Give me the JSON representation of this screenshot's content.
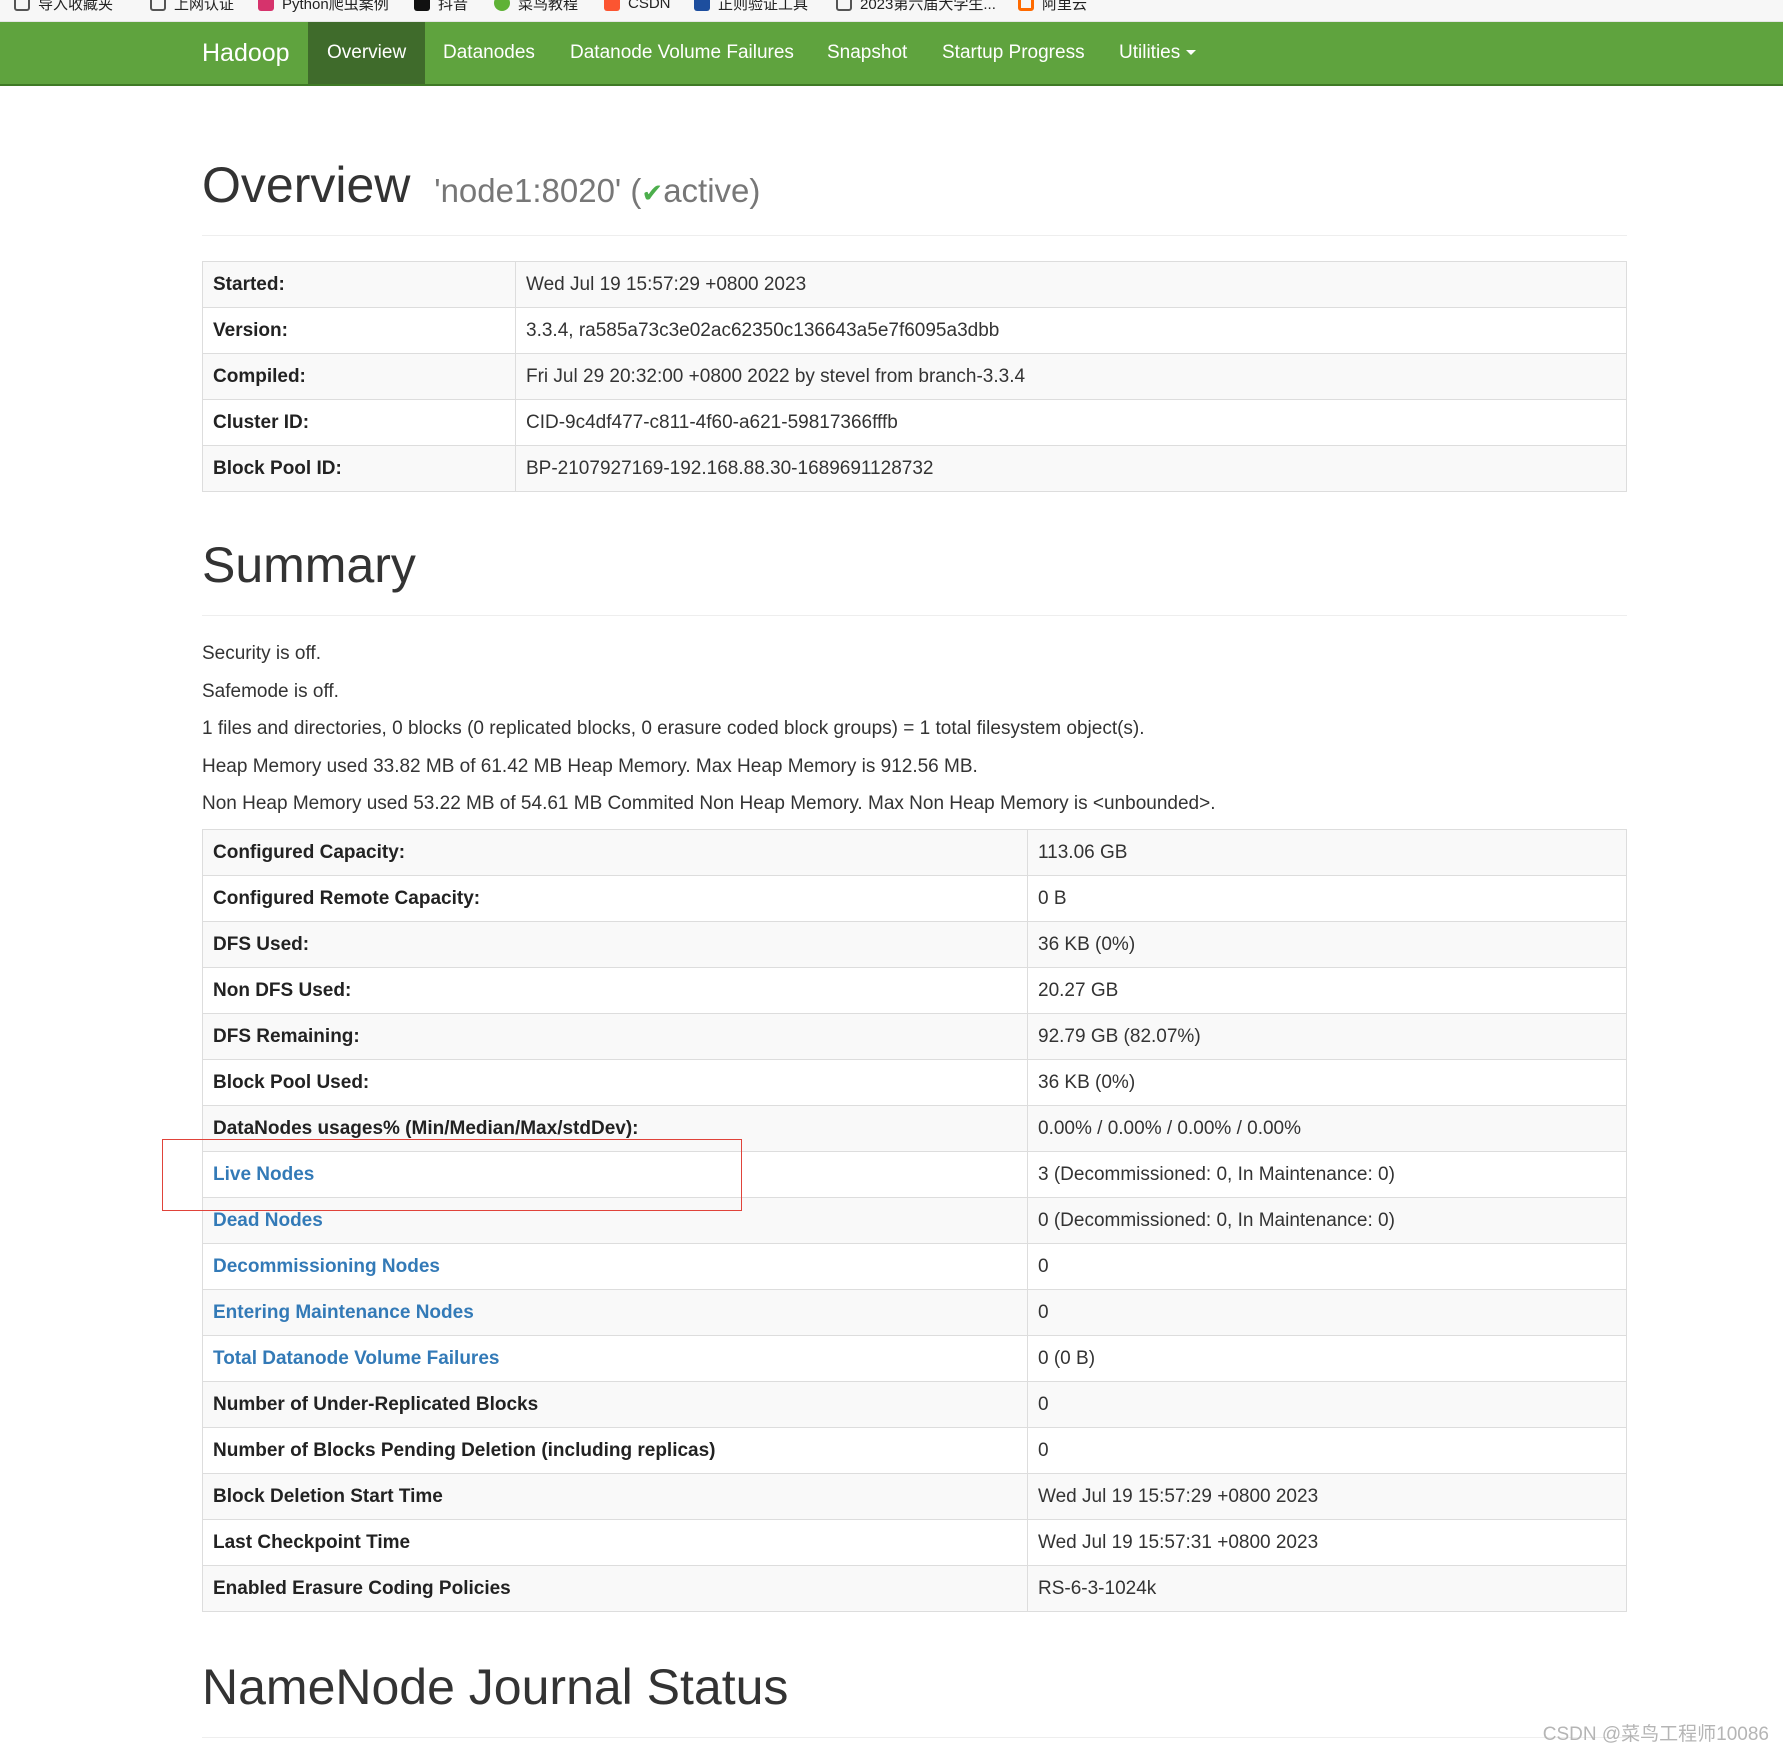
{
  "bookmarks": [
    {
      "label": "导入收藏夹",
      "color": "#555555"
    },
    {
      "label": "上网认证",
      "color": "#555555"
    },
    {
      "label": "Python爬虫案例",
      "color": "#d6336c"
    },
    {
      "label": "抖音",
      "color": "#111111"
    },
    {
      "label": "菜鸟教程",
      "color": "#5fb236"
    },
    {
      "label": "CSDN",
      "color": "#fc5531"
    },
    {
      "label": "正则验证工具",
      "color": "#1d4e9e"
    },
    {
      "label": "2023第六届大学生...",
      "color": "#555555"
    },
    {
      "label": "阿里云",
      "color": "#ff6a00"
    }
  ],
  "navbar": {
    "brand": "Hadoop",
    "items": [
      {
        "label": "Overview",
        "active": true
      },
      {
        "label": "Datanodes"
      },
      {
        "label": "Datanode Volume Failures"
      },
      {
        "label": "Snapshot"
      },
      {
        "label": "Startup Progress"
      },
      {
        "label": "Utilities",
        "dropdown": true
      }
    ],
    "colors": {
      "bar": "#5fa33e",
      "active": "#3f6b2b"
    }
  },
  "overview": {
    "title": "Overview",
    "host": "'node1:8020'",
    "state_open": "(",
    "state_icon": "✔",
    "state": "active)",
    "rows": [
      {
        "label": "Started:",
        "value": "Wed Jul 19 15:57:29 +0800 2023"
      },
      {
        "label": "Version:",
        "value": "3.3.4, ra585a73c3e02ac62350c136643a5e7f6095a3dbb"
      },
      {
        "label": "Compiled:",
        "value": "Fri Jul 29 20:32:00 +0800 2022 by stevel from branch-3.3.4"
      },
      {
        "label": "Cluster ID:",
        "value": "CID-9c4df477-c811-4f60-a621-59817366fffb"
      },
      {
        "label": "Block Pool ID:",
        "value": "BP-2107927169-192.168.88.30-1689691128732"
      }
    ]
  },
  "summary": {
    "title": "Summary",
    "lines": [
      "Security is off.",
      "Safemode is off.",
      "1 files and directories, 0 blocks (0 replicated blocks, 0 erasure coded block groups) = 1 total filesystem object(s).",
      "Heap Memory used 33.82 MB of 61.42 MB Heap Memory. Max Heap Memory is 912.56 MB.",
      "Non Heap Memory used 53.22 MB of 54.61 MB Commited Non Heap Memory. Max Non Heap Memory is <unbounded>."
    ],
    "rows": [
      {
        "label": "Configured Capacity:",
        "value": "113.06 GB"
      },
      {
        "label": "Configured Remote Capacity:",
        "value": "0 B"
      },
      {
        "label": "DFS Used:",
        "value": "36 KB (0%)"
      },
      {
        "label": "Non DFS Used:",
        "value": "20.27 GB"
      },
      {
        "label": "DFS Remaining:",
        "value": "92.79 GB (82.07%)"
      },
      {
        "label": "Block Pool Used:",
        "value": "36 KB (0%)"
      },
      {
        "label": "DataNodes usages% (Min/Median/Max/stdDev):",
        "value": "0.00% / 0.00% / 0.00% / 0.00%"
      },
      {
        "label": "Live Nodes",
        "value": "3 (Decommissioned: 0, In Maintenance: 0)",
        "link": true
      },
      {
        "label": "Dead Nodes",
        "value": "0 (Decommissioned: 0, In Maintenance: 0)",
        "link": true
      },
      {
        "label": "Decommissioning Nodes",
        "value": "0",
        "link": true
      },
      {
        "label": "Entering Maintenance Nodes",
        "value": "0",
        "link": true
      },
      {
        "label": "Total Datanode Volume Failures",
        "value": "0 (0 B)",
        "link": true
      },
      {
        "label": "Number of Under-Replicated Blocks",
        "value": "0"
      },
      {
        "label": "Number of Blocks Pending Deletion (including replicas)",
        "value": "0"
      },
      {
        "label": "Block Deletion Start Time",
        "value": "Wed Jul 19 15:57:29 +0800 2023"
      },
      {
        "label": "Last Checkpoint Time",
        "value": "Wed Jul 19 15:57:31 +0800 2023"
      },
      {
        "label": "Enabled Erasure Coding Policies",
        "value": "RS-6-3-1024k"
      }
    ]
  },
  "journal": {
    "title": "NameNode Journal Status"
  },
  "watermark": "CSDN @菜鸟工程师10086"
}
